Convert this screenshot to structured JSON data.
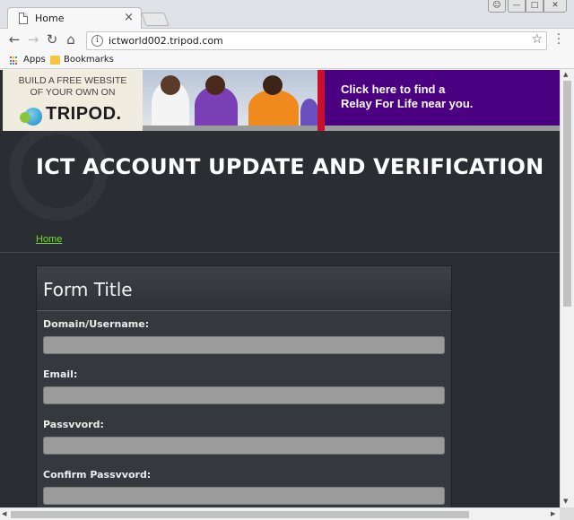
{
  "browser": {
    "tab_title": "Home",
    "tab_close": "×",
    "url": "ictworld002.tripod.com",
    "bookmarks": [
      {
        "label": "Apps"
      },
      {
        "label": "Bookmarks"
      }
    ]
  },
  "ad": {
    "left_text_1": "BUILD A FREE WEBSITE",
    "left_text_2": "OF YOUR OWN ON",
    "logo": "TRIPOD.",
    "right_text_1": "Click here to find a",
    "right_text_2": "Relay For Life near you."
  },
  "page": {
    "site_title": "ICT ACCOUNT UPDATE AND VERIFICATION",
    "nav_home": "Home"
  },
  "form": {
    "title": "Form Title",
    "fields": [
      {
        "label": "Domain/Username:",
        "value": ""
      },
      {
        "label": "Email:",
        "value": ""
      },
      {
        "label": "Passvvord:",
        "value": ""
      },
      {
        "label": "Confirm Passvvord:",
        "value": ""
      }
    ]
  },
  "colors": {
    "page_bg": "#2a2d31",
    "link_green": "#6fdc2c",
    "ad_purple": "#4b0082",
    "input_gray": "#9b9b9b"
  }
}
